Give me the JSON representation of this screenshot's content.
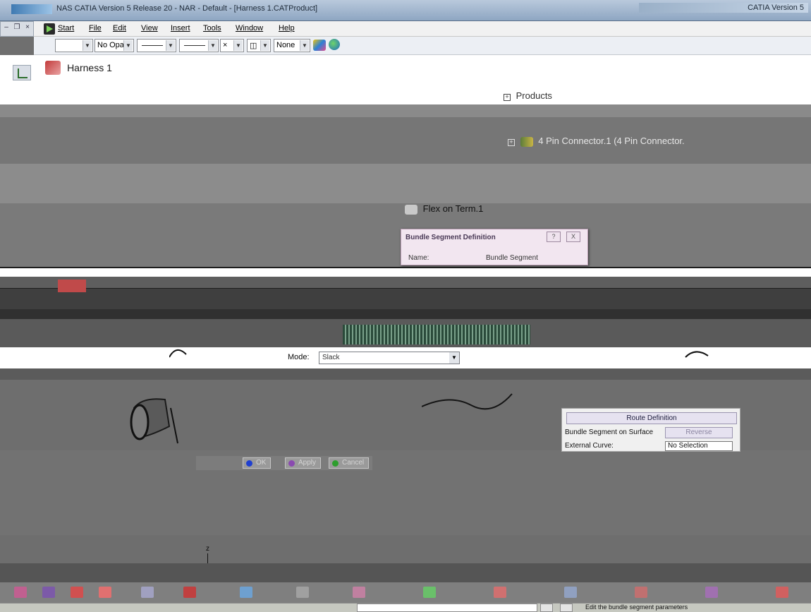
{
  "window": {
    "title": "NAS CATIA Version 5 Release 20 - NAR - Default - [Harness 1.CATProduct]",
    "right_title": "CATIA Version 5"
  },
  "menu": {
    "items": [
      "Start",
      "File",
      "Edit",
      "View",
      "Insert",
      "Tools",
      "Window",
      "Help"
    ]
  },
  "toolbar": {
    "color_value": "",
    "opacity_value": "No Opa",
    "layer_value": "None"
  },
  "tree": {
    "root": "Harness 1",
    "products": "Products",
    "connector": "4 Pin Connector.1 (4 Pin Connector.",
    "terminal": "Flex on Term.1"
  },
  "dialog": {
    "title": "Bundle Segment Definition",
    "help_label": "?",
    "close_label": "X",
    "name_label": "Name:",
    "name_value": "Bundle Segment"
  },
  "mode": {
    "label": "Mode:",
    "value": "Slack"
  },
  "route_panel": {
    "route_button": "Route Definition",
    "surface_label": "Bundle Segment on Surface",
    "reverse_button": "Reverse",
    "external_label": "External Curve:",
    "external_value": "No Selection"
  },
  "actions": {
    "ok": "OK",
    "apply": "Apply",
    "cancel": "Cancel"
  },
  "axis": {
    "z": "z"
  },
  "status": {
    "message": "Edit the bundle segment parameters"
  },
  "colors": {
    "titlebar": "#8ea6c2",
    "viewport": "#6e6e6e",
    "dialog": "#f2e6f0",
    "ok_dot": "#1f3fd0",
    "apply_dot": "#8a4ab0",
    "cancel_dot": "#2e9e2e"
  }
}
